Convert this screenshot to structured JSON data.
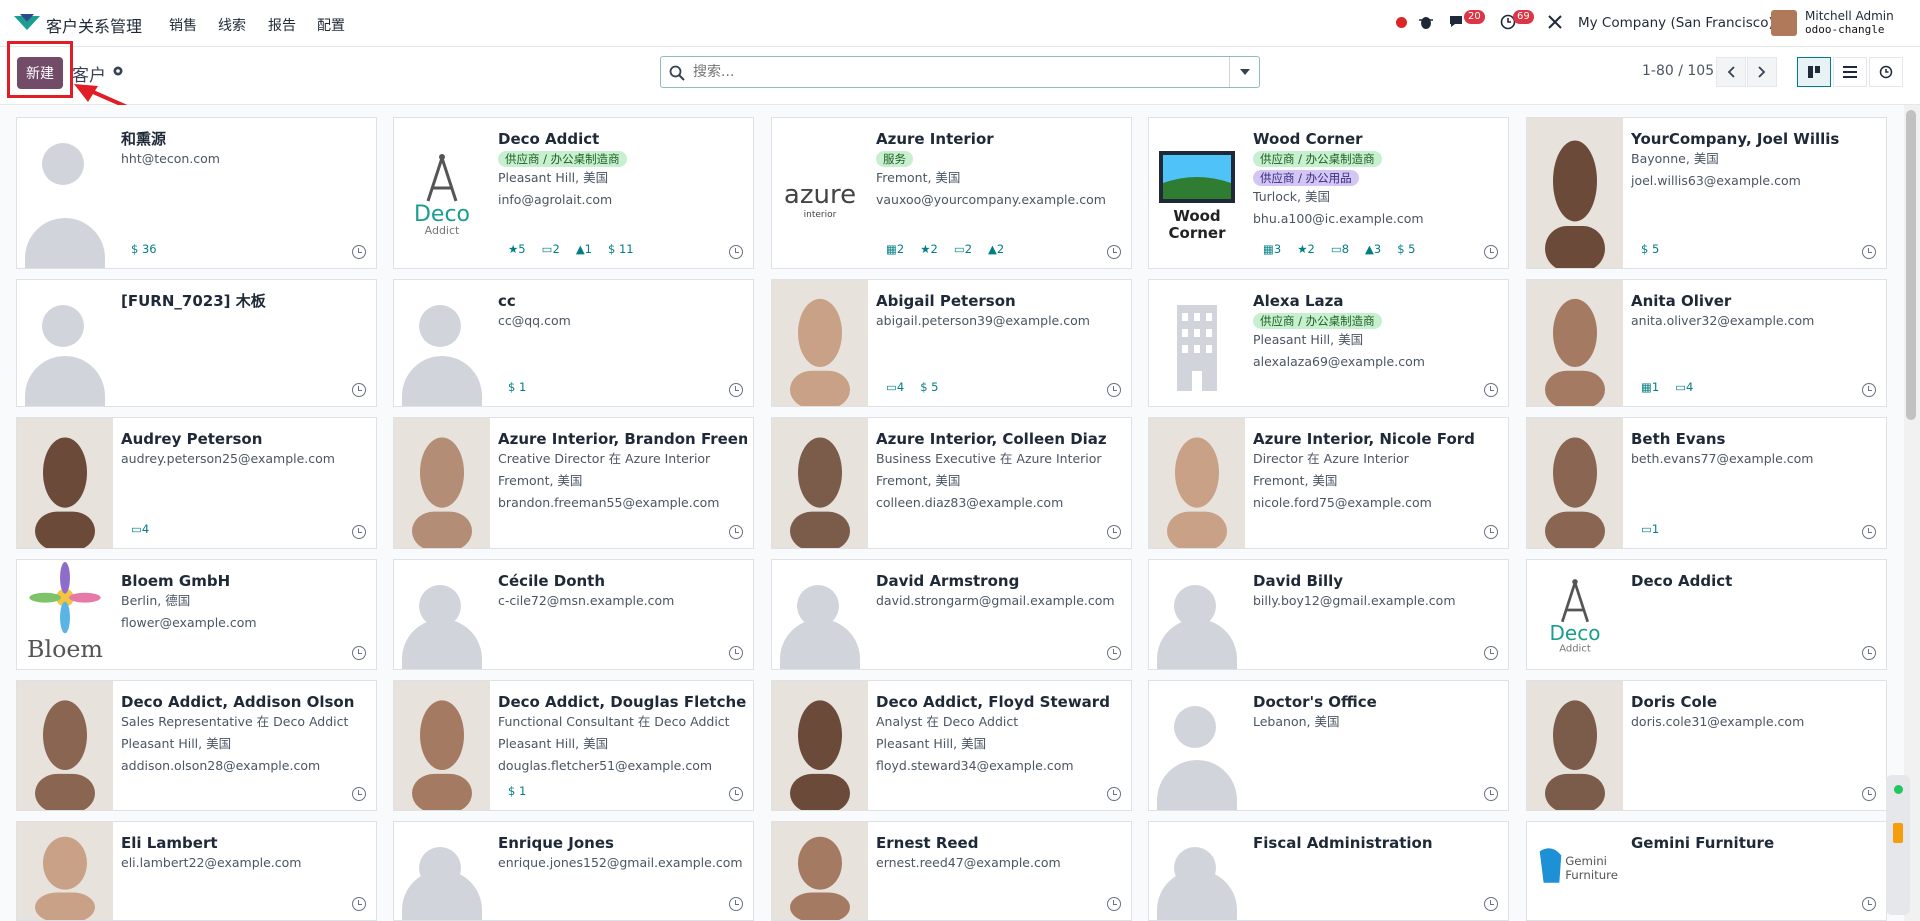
{
  "topbar": {
    "app_name": "客户关系管理",
    "menu": [
      "销售",
      "线索",
      "报告",
      "配置"
    ],
    "messages_count": "20",
    "activities_count": "69",
    "company": "My Company (San Francisco)",
    "user_name": "Mitchell Admin",
    "user_db": "odoo-changle"
  },
  "control": {
    "new_label": "新建",
    "breadcrumb": "客户",
    "search_placeholder": "搜索...",
    "pager": "1-80 / 105"
  },
  "colors": {
    "primary": "#714b67",
    "accent": "#017e84",
    "highlight": "#e11d27"
  },
  "cards": [
    {
      "name": "和熏源",
      "lines": [
        "hht@tecon.com"
      ],
      "tags": [],
      "stats": [
        "$ 36"
      ],
      "img": "placeholder"
    },
    {
      "name": "Deco Addict",
      "lines": [
        "Pleasant Hill, 美国",
        "info@agrolait.com"
      ],
      "tags": [
        {
          "text": "供应商 / 办公桌制造商",
          "color": "green"
        }
      ],
      "stats": [
        "★5",
        "▭2",
        "▲1",
        "$ 11"
      ],
      "img": "deco"
    },
    {
      "name": "Azure Interior",
      "lines": [
        "Fremont, 美国",
        "vauxoo@yourcompany.example.com"
      ],
      "tags": [
        {
          "text": "服务",
          "color": "green"
        }
      ],
      "stats": [
        "▦2",
        "★2",
        "▭2",
        "▲2"
      ],
      "img": "azure"
    },
    {
      "name": "Wood Corner",
      "lines": [
        "Turlock, 美国",
        "bhu.a100@ic.example.com"
      ],
      "tags": [
        {
          "text": "供应商 / 办公桌制造商",
          "color": "green"
        },
        {
          "text": "供应商 / 办公用品",
          "color": "purple"
        }
      ],
      "stats": [
        "▦3",
        "★2",
        "▭8",
        "▲3",
        "$ 5"
      ],
      "img": "wood"
    },
    {
      "name": "YourCompany, Joel Willis",
      "lines": [
        "Bayonne, 美国",
        "joel.willis63@example.com"
      ],
      "tags": [],
      "stats": [
        "$ 5"
      ],
      "img": "photo"
    },
    {
      "name": "[FURN_7023] 木板",
      "lines": [],
      "tags": [],
      "stats": [],
      "img": "placeholder"
    },
    {
      "name": "cc",
      "lines": [
        "cc@qq.com"
      ],
      "tags": [],
      "stats": [
        "$ 1"
      ],
      "img": "placeholder"
    },
    {
      "name": "Abigail Peterson",
      "lines": [
        "abigail.peterson39@example.com"
      ],
      "tags": [],
      "stats": [
        "▭4",
        "$ 5"
      ],
      "img": "photo"
    },
    {
      "name": "Alexa Laza",
      "lines": [
        "Pleasant Hill, 美国",
        "alexalaza69@example.com"
      ],
      "tags": [
        {
          "text": "供应商 / 办公桌制造商",
          "color": "green"
        }
      ],
      "stats": [],
      "img": "building"
    },
    {
      "name": "Anita Oliver",
      "lines": [
        "anita.oliver32@example.com"
      ],
      "tags": [],
      "stats": [
        "▦1",
        "▭4"
      ],
      "img": "photo"
    },
    {
      "name": "Audrey Peterson",
      "lines": [
        "audrey.peterson25@example.com"
      ],
      "tags": [],
      "stats": [
        "▭4"
      ],
      "img": "photo"
    },
    {
      "name": "Azure Interior, Brandon Freeman",
      "lines": [
        "Creative Director 在 Azure Interior",
        "Fremont, 美国",
        "brandon.freeman55@example.com"
      ],
      "tags": [],
      "stats": [],
      "img": "photo"
    },
    {
      "name": "Azure Interior, Colleen Diaz",
      "lines": [
        "Business Executive 在 Azure Interior",
        "Fremont, 美国",
        "colleen.diaz83@example.com"
      ],
      "tags": [],
      "stats": [],
      "img": "photo"
    },
    {
      "name": "Azure Interior, Nicole Ford",
      "lines": [
        "Director 在 Azure Interior",
        "Fremont, 美国",
        "nicole.ford75@example.com"
      ],
      "tags": [],
      "stats": [],
      "img": "photo"
    },
    {
      "name": "Beth Evans",
      "lines": [
        "beth.evans77@example.com"
      ],
      "tags": [],
      "stats": [
        "▭1"
      ],
      "img": "photo"
    },
    {
      "name": "Bloem GmbH",
      "lines": [
        "Berlin, 德国",
        "flower@example.com"
      ],
      "tags": [],
      "stats": [],
      "img": "bloem"
    },
    {
      "name": "Cécile Donth",
      "lines": [
        "c-cile72@msn.example.com"
      ],
      "tags": [],
      "stats": [],
      "img": "placeholder"
    },
    {
      "name": "David Armstrong",
      "lines": [
        "david.strongarm@gmail.example.com"
      ],
      "tags": [],
      "stats": [],
      "img": "placeholder"
    },
    {
      "name": "David Billy",
      "lines": [
        "billy.boy12@gmail.example.com"
      ],
      "tags": [],
      "stats": [],
      "img": "placeholder"
    },
    {
      "name": "Deco Addict",
      "lines": [],
      "tags": [],
      "stats": [],
      "img": "deco"
    },
    {
      "name": "Deco Addict, Addison Olson",
      "lines": [
        "Sales Representative 在 Deco Addict",
        "Pleasant Hill, 美国",
        "addison.olson28@example.com"
      ],
      "tags": [],
      "stats": [],
      "img": "photo"
    },
    {
      "name": "Deco Addict, Douglas Fletcher",
      "lines": [
        "Functional Consultant 在 Deco Addict",
        "Pleasant Hill, 美国",
        "douglas.fletcher51@example.com"
      ],
      "tags": [],
      "stats": [
        "$ 1"
      ],
      "img": "photo"
    },
    {
      "name": "Deco Addict, Floyd Steward",
      "lines": [
        "Analyst 在 Deco Addict",
        "Pleasant Hill, 美国",
        "floyd.steward34@example.com"
      ],
      "tags": [],
      "stats": [],
      "img": "photo"
    },
    {
      "name": "Doctor's Office",
      "lines": [
        "Lebanon, 美国"
      ],
      "tags": [],
      "stats": [],
      "img": "placeholder"
    },
    {
      "name": "Doris Cole",
      "lines": [
        "doris.cole31@example.com"
      ],
      "tags": [],
      "stats": [],
      "img": "photo"
    },
    {
      "name": "Eli Lambert",
      "lines": [
        "eli.lambert22@example.com"
      ],
      "tags": [],
      "stats": [],
      "img": "photo"
    },
    {
      "name": "Enrique Jones",
      "lines": [
        "enrique.jones152@gmail.example.com"
      ],
      "tags": [],
      "stats": [],
      "img": "placeholder"
    },
    {
      "name": "Ernest Reed",
      "lines": [
        "ernest.reed47@example.com"
      ],
      "tags": [],
      "stats": [],
      "img": "photo"
    },
    {
      "name": "Fiscal Administration",
      "lines": [],
      "tags": [],
      "stats": [],
      "img": "placeholder"
    },
    {
      "name": "Gemini Furniture",
      "lines": [],
      "tags": [],
      "stats": [],
      "img": "gemini"
    }
  ]
}
